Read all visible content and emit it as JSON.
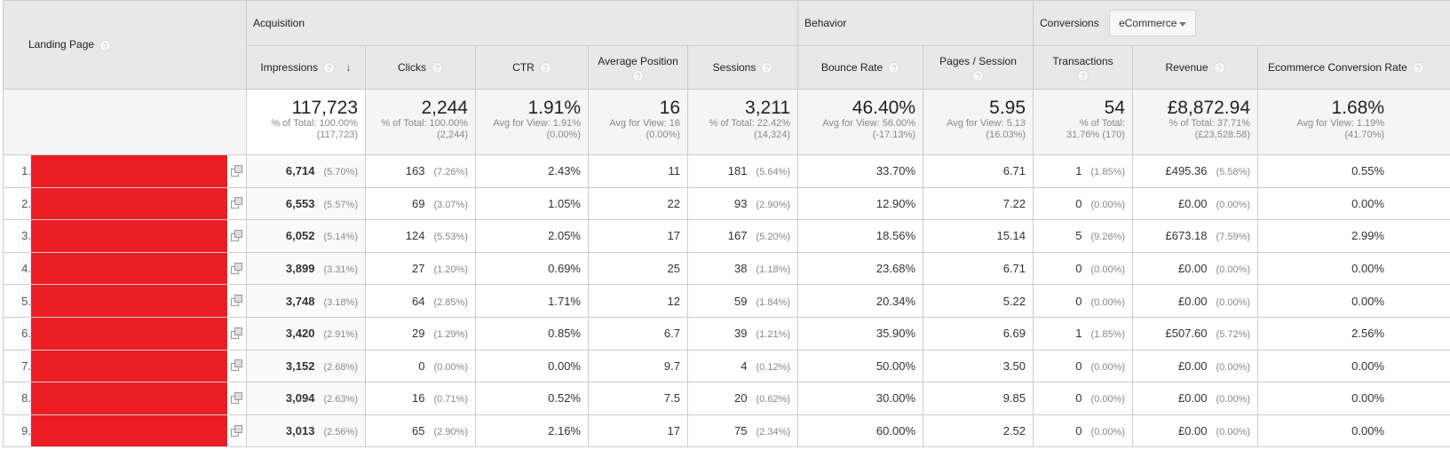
{
  "header": {
    "landing_page": "Landing Page",
    "groups": {
      "acquisition": "Acquisition",
      "behavior": "Behavior",
      "conversions": "Conversions"
    },
    "conversions_select": {
      "value": "eCommerce"
    },
    "columns": {
      "impressions": "Impressions",
      "clicks": "Clicks",
      "ctr": "CTR",
      "avg_position": "Average Position",
      "sessions": "Sessions",
      "bounce_rate": "Bounce Rate",
      "pages_session": "Pages / Session",
      "transactions": "Transactions",
      "revenue": "Revenue",
      "ecomm_rate": "Ecommerce Conversion Rate"
    },
    "help_icon": "?",
    "sort_icon": "↓"
  },
  "totals": {
    "impressions": {
      "value": "117,723",
      "sub1": "% of Total: 100.00%",
      "sub2": "(117,723)"
    },
    "clicks": {
      "value": "2,244",
      "sub1": "% of Total: 100.00%",
      "sub2": "(2,244)"
    },
    "ctr": {
      "value": "1.91%",
      "sub1": "Avg for View: 1.91%",
      "sub2": "(0.00%)"
    },
    "avg_position": {
      "value": "16",
      "sub1": "Avg for View: 16",
      "sub2": "(0.00%)"
    },
    "sessions": {
      "value": "3,211",
      "sub1": "% of Total: 22.42%",
      "sub2": "(14,324)"
    },
    "bounce_rate": {
      "value": "46.40%",
      "sub1": "Avg for View: 56.00%",
      "sub2": "(-17.13%)"
    },
    "pages_session": {
      "value": "5.95",
      "sub1": "Avg for View: 5.13",
      "sub2": "(16.03%)"
    },
    "transactions": {
      "value": "54",
      "sub1": "% of Total:",
      "sub2": "31.76% (170)"
    },
    "revenue": {
      "value": "£8,872.94",
      "sub1": "% of Total: 37.71%",
      "sub2": "(£23,528.58)"
    },
    "ecomm_rate": {
      "value": "1.68%",
      "sub1": "Avg for View: 1.19%",
      "sub2": "(41.70%)"
    }
  },
  "rows": [
    {
      "idx": "1.",
      "impressions": "6,714",
      "impressions_pct": "(5.70%)",
      "clicks": "163",
      "clicks_pct": "(7.26%)",
      "ctr": "2.43%",
      "avg_position": "11",
      "sessions": "181",
      "sessions_pct": "(5.64%)",
      "bounce_rate": "33.70%",
      "pages_session": "6.71",
      "transactions": "1",
      "transactions_pct": "(1.85%)",
      "revenue": "£495.36",
      "revenue_pct": "(5.58%)",
      "ecomm_rate": "0.55%"
    },
    {
      "idx": "2.",
      "impressions": "6,553",
      "impressions_pct": "(5.57%)",
      "clicks": "69",
      "clicks_pct": "(3.07%)",
      "ctr": "1.05%",
      "avg_position": "22",
      "sessions": "93",
      "sessions_pct": "(2.90%)",
      "bounce_rate": "12.90%",
      "pages_session": "7.22",
      "transactions": "0",
      "transactions_pct": "(0.00%)",
      "revenue": "£0.00",
      "revenue_pct": "(0.00%)",
      "ecomm_rate": "0.00%"
    },
    {
      "idx": "3.",
      "impressions": "6,052",
      "impressions_pct": "(5.14%)",
      "clicks": "124",
      "clicks_pct": "(5.53%)",
      "ctr": "2.05%",
      "avg_position": "17",
      "sessions": "167",
      "sessions_pct": "(5.20%)",
      "bounce_rate": "18.56%",
      "pages_session": "15.14",
      "transactions": "5",
      "transactions_pct": "(9.26%)",
      "revenue": "£673.18",
      "revenue_pct": "(7.59%)",
      "ecomm_rate": "2.99%"
    },
    {
      "idx": "4.",
      "impressions": "3,899",
      "impressions_pct": "(3.31%)",
      "clicks": "27",
      "clicks_pct": "(1.20%)",
      "ctr": "0.69%",
      "avg_position": "25",
      "sessions": "38",
      "sessions_pct": "(1.18%)",
      "bounce_rate": "23.68%",
      "pages_session": "6.71",
      "transactions": "0",
      "transactions_pct": "(0.00%)",
      "revenue": "£0.00",
      "revenue_pct": "(0.00%)",
      "ecomm_rate": "0.00%"
    },
    {
      "idx": "5.",
      "impressions": "3,748",
      "impressions_pct": "(3.18%)",
      "clicks": "64",
      "clicks_pct": "(2.85%)",
      "ctr": "1.71%",
      "avg_position": "12",
      "sessions": "59",
      "sessions_pct": "(1.84%)",
      "bounce_rate": "20.34%",
      "pages_session": "5.22",
      "transactions": "0",
      "transactions_pct": "(0.00%)",
      "revenue": "£0.00",
      "revenue_pct": "(0.00%)",
      "ecomm_rate": "0.00%"
    },
    {
      "idx": "6.",
      "impressions": "3,420",
      "impressions_pct": "(2.91%)",
      "clicks": "29",
      "clicks_pct": "(1.29%)",
      "ctr": "0.85%",
      "avg_position": "6.7",
      "sessions": "39",
      "sessions_pct": "(1.21%)",
      "bounce_rate": "35.90%",
      "pages_session": "6.69",
      "transactions": "1",
      "transactions_pct": "(1.85%)",
      "revenue": "£507.60",
      "revenue_pct": "(5.72%)",
      "ecomm_rate": "2.56%"
    },
    {
      "idx": "7.",
      "impressions": "3,152",
      "impressions_pct": "(2.68%)",
      "clicks": "0",
      "clicks_pct": "(0.00%)",
      "ctr": "0.00%",
      "avg_position": "9.7",
      "sessions": "4",
      "sessions_pct": "(0.12%)",
      "bounce_rate": "50.00%",
      "pages_session": "3.50",
      "transactions": "0",
      "transactions_pct": "(0.00%)",
      "revenue": "£0.00",
      "revenue_pct": "(0.00%)",
      "ecomm_rate": "0.00%"
    },
    {
      "idx": "8.",
      "impressions": "3,094",
      "impressions_pct": "(2.63%)",
      "clicks": "16",
      "clicks_pct": "(0.71%)",
      "ctr": "0.52%",
      "avg_position": "7.5",
      "sessions": "20",
      "sessions_pct": "(0.62%)",
      "bounce_rate": "30.00%",
      "pages_session": "9.85",
      "transactions": "0",
      "transactions_pct": "(0.00%)",
      "revenue": "£0.00",
      "revenue_pct": "(0.00%)",
      "ecomm_rate": "0.00%"
    },
    {
      "idx": "9.",
      "impressions": "3,013",
      "impressions_pct": "(2.56%)",
      "clicks": "65",
      "clicks_pct": "(2.90%)",
      "ctr": "2.16%",
      "avg_position": "17",
      "sessions": "75",
      "sessions_pct": "(2.34%)",
      "bounce_rate": "60.00%",
      "pages_session": "2.52",
      "transactions": "0",
      "transactions_pct": "(0.00%)",
      "revenue": "£0.00",
      "revenue_pct": "(0.00%)",
      "ecomm_rate": "0.00%"
    }
  ],
  "colors": {
    "redaction": "#ec1c24",
    "header_bg": "#e8e8e8",
    "border": "#cccccc"
  }
}
